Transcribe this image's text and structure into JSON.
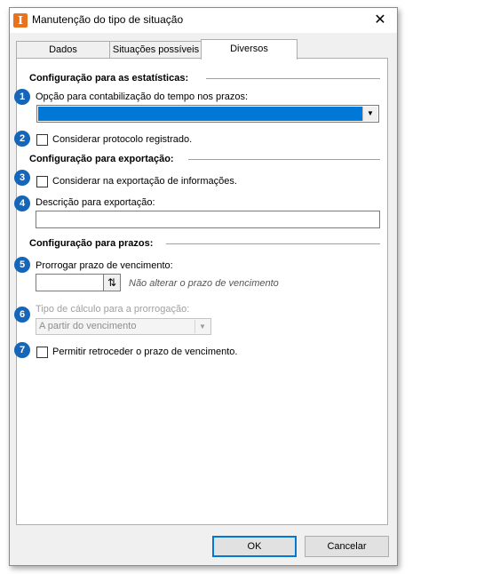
{
  "window": {
    "title": "Manutenção do tipo de situação",
    "icon_letter": "I",
    "close_glyph": "✕"
  },
  "tabs": [
    {
      "label": "Dados"
    },
    {
      "label": "Situações possíveis"
    },
    {
      "label": "Diversos",
      "active": true
    }
  ],
  "stats_section": {
    "title": "Configuração para as estatísticas:",
    "badge1": "1",
    "combo_label": "Opção para contabilização do tempo nos prazos:",
    "combo_value": "",
    "badge2": "2",
    "checkbox_label": "Considerar protocolo registrado.",
    "checked": false
  },
  "export_section": {
    "title": "Configuração para exportação:",
    "badge3": "3",
    "checkbox_label": "Considerar na exportação de informações.",
    "checked": false,
    "badge4": "4",
    "description_label": "Descrição para exportação:",
    "description_value": ""
  },
  "deadline_section": {
    "title": "Configuração para prazos:",
    "badge5": "5",
    "extend_label": "Prorrogar prazo de vencimento:",
    "extend_value": "",
    "extend_hint": "Não alterar o prazo de vencimento",
    "badge6": "6",
    "calc_label": "Tipo de cálculo para a prorrogação:",
    "calc_value": "A partir do vencimento",
    "badge7": "7",
    "allow_back_label": "Permitir retroceder o prazo de vencimento.",
    "allow_back_checked": false
  },
  "buttons": {
    "ok": "OK",
    "cancel": "Cancelar"
  },
  "colors": {
    "accent": "#0078d7",
    "badge": "#1565b8",
    "app_icon": "#e8731c"
  }
}
